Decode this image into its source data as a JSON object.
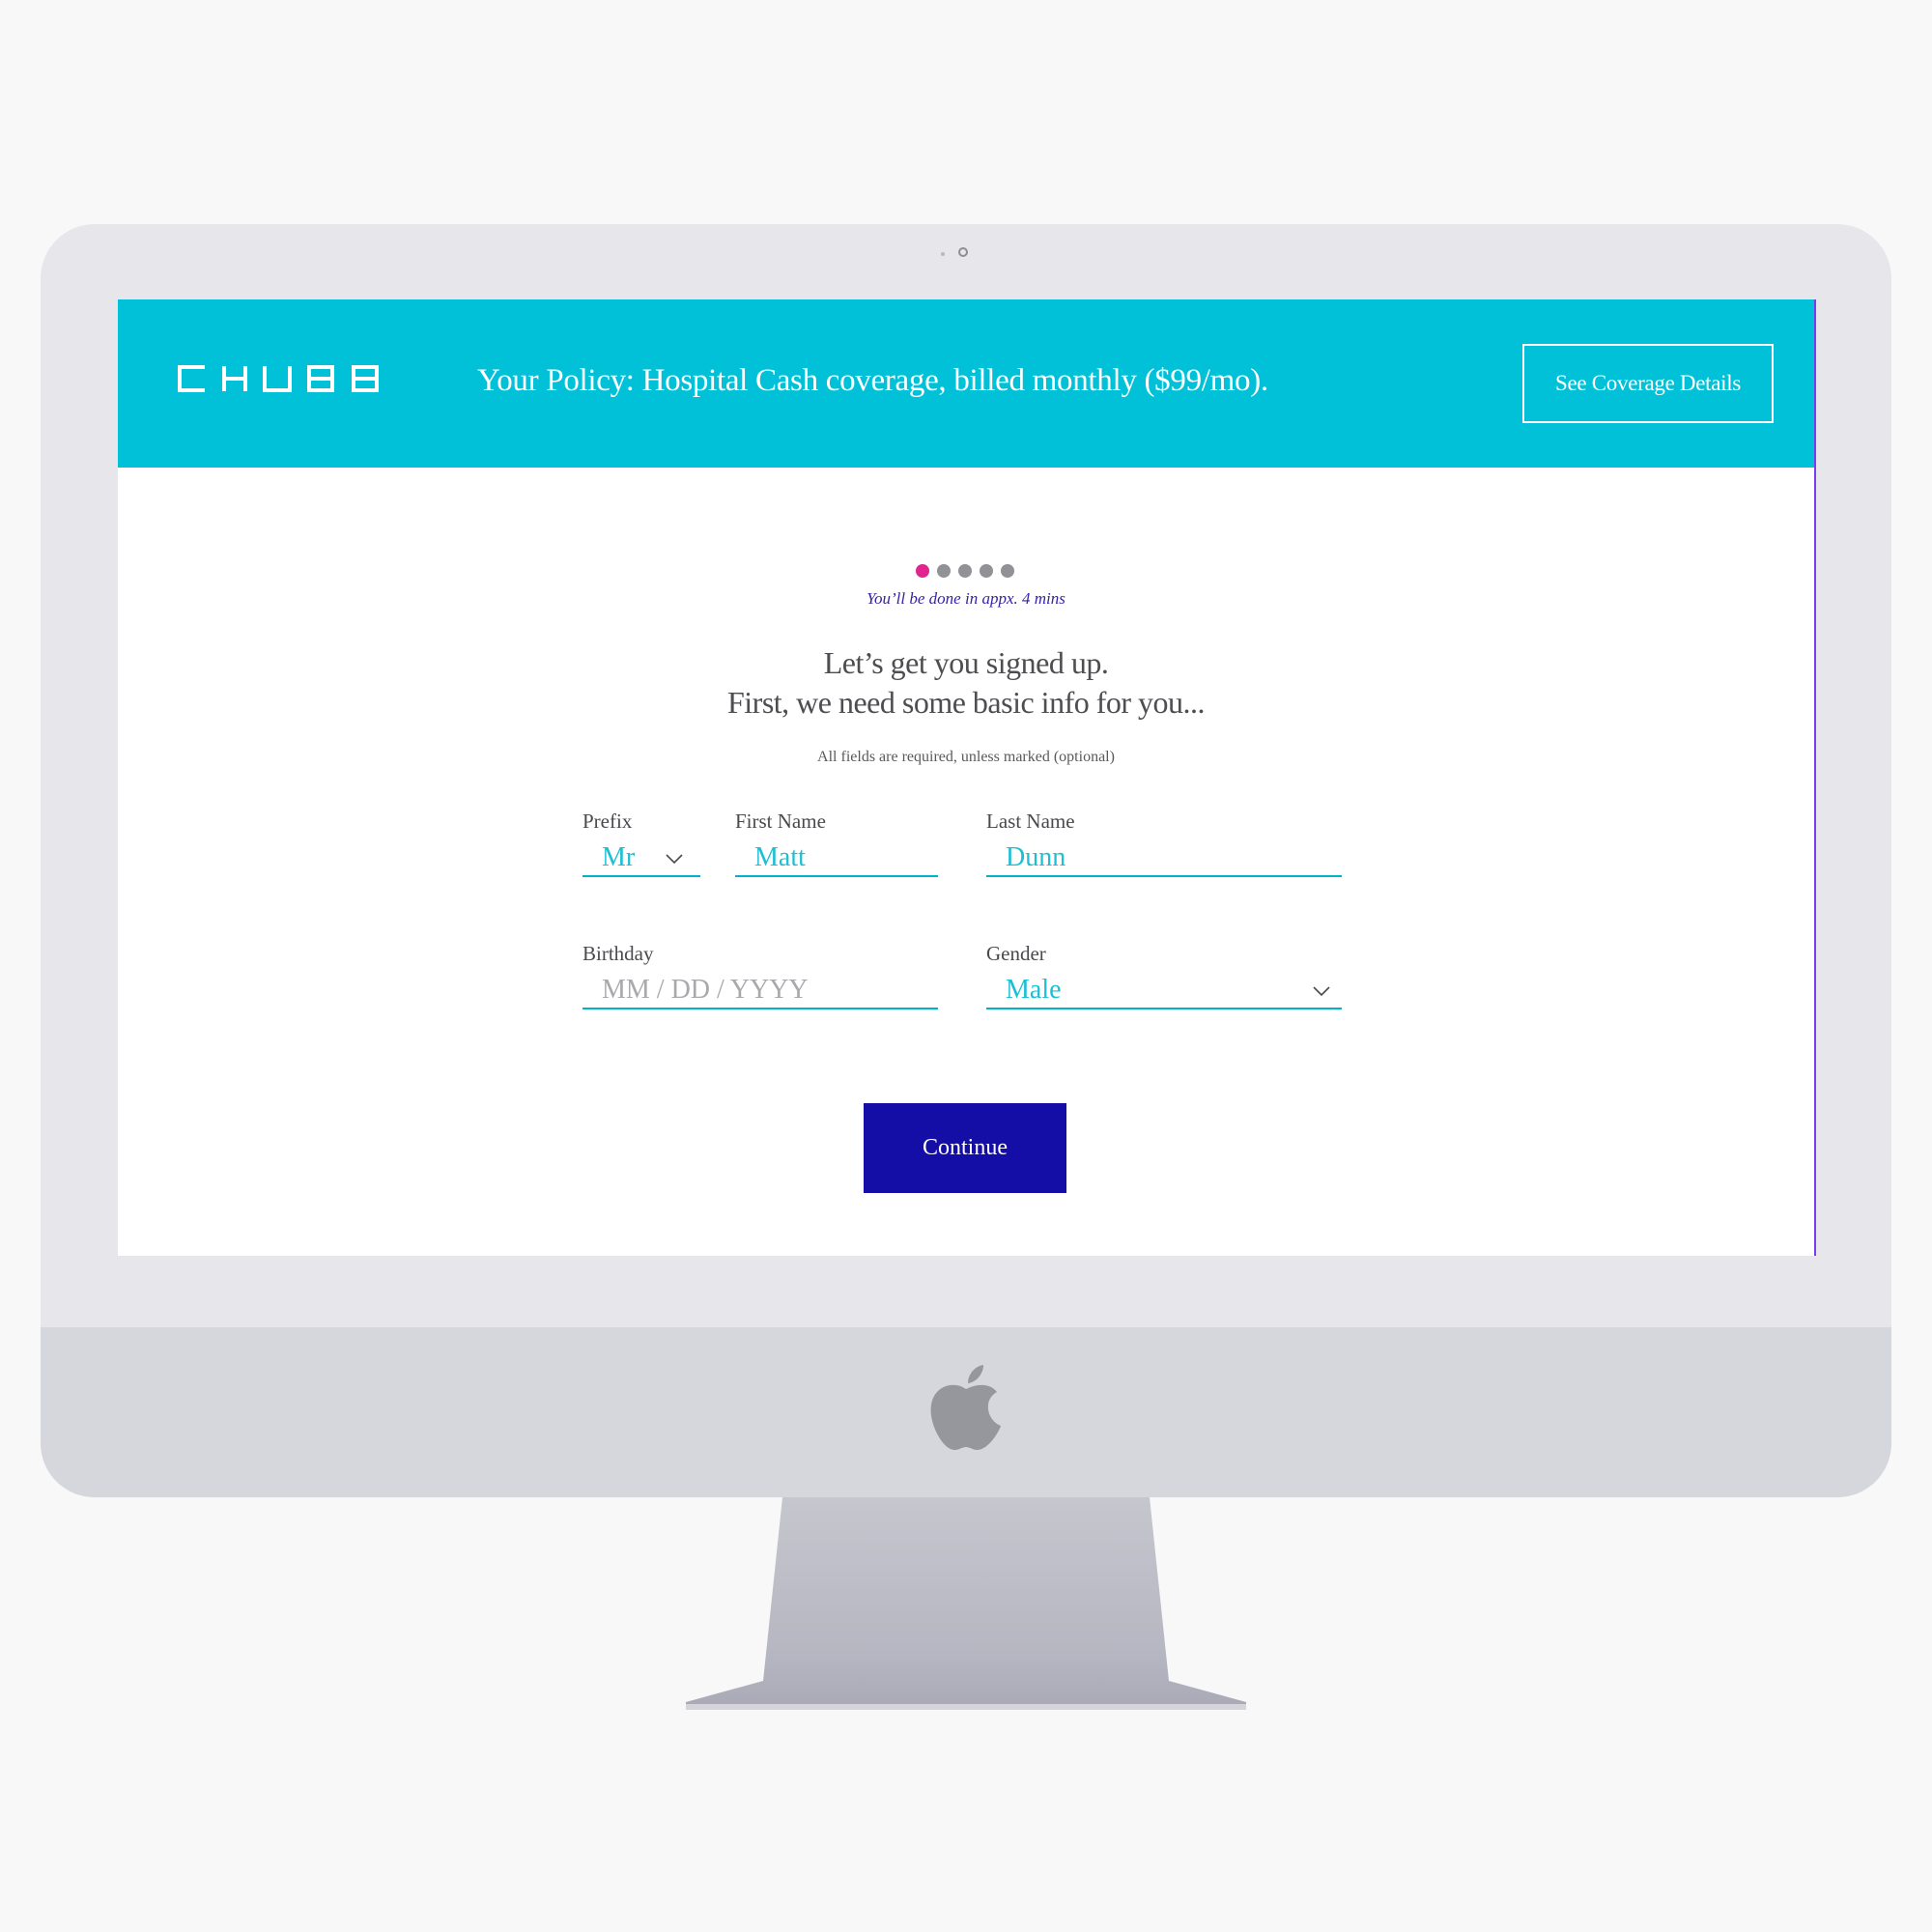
{
  "header": {
    "logo_text": "CHUBB",
    "policy_summary": "Your Policy: Hospital Cash coverage, billed monthly ($99/mo).",
    "coverage_button_label": "See Coverage Details"
  },
  "progress": {
    "total_steps": 5,
    "current_step": 1,
    "eta_text": "You’ll be done in appx. 4 mins"
  },
  "intro": {
    "line1": "Let’s get you signed up.",
    "line2": "First, we need some basic info for you...",
    "required_note": "All fields are required, unless marked (optional)"
  },
  "form": {
    "prefix": {
      "label": "Prefix",
      "value": "Mr"
    },
    "first_name": {
      "label": "First Name",
      "value": "Matt"
    },
    "last_name": {
      "label": "Last Name",
      "value": "Dunn"
    },
    "birthday": {
      "label": "Birthday",
      "value": "",
      "placeholder": "MM / DD / YYYY"
    },
    "gender": {
      "label": "Gender",
      "value": "Male"
    }
  },
  "continue_button_label": "Continue",
  "colors": {
    "brand_teal": "#00c1d7",
    "accent_pink": "#e0258e",
    "primary_navy": "#140ea6",
    "input_teal": "#1cbfd4"
  }
}
